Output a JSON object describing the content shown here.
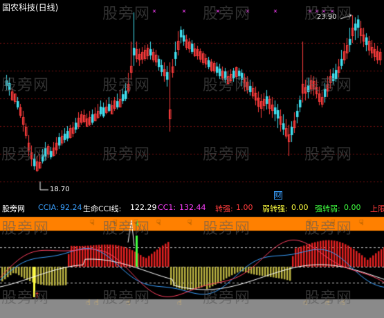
{
  "title": "国农科技(日线)",
  "high_label": "23.90",
  "low_label": "18.70",
  "cai_label": "财",
  "indicator": {
    "name": "股旁网",
    "ccia_label": "CCIA:",
    "ccia_value": "92.24",
    "life_label": "生命CCI线:",
    "life_value": "122.29",
    "cc1_label": "CC1:",
    "cc1_value": "132.44",
    "turn_strong_label": "转强:",
    "turn_strong_value": "1.00",
    "weak_to_strong_label": "弱转强:",
    "weak_to_strong_value": "0.00",
    "strong_to_weak_label": "强转弱:",
    "strong_to_weak_value": "0.00",
    "upper_label": "上限"
  },
  "watermark": "股旁网",
  "colors": {
    "up": "#ff3c3c",
    "down": "#40e0f0",
    "ccia": "#3aa0ff",
    "cc1": "#ff40ff",
    "orange": "#ff8000",
    "yellow": "#ffff40",
    "green": "#40ff40",
    "gray": "#808080"
  }
}
